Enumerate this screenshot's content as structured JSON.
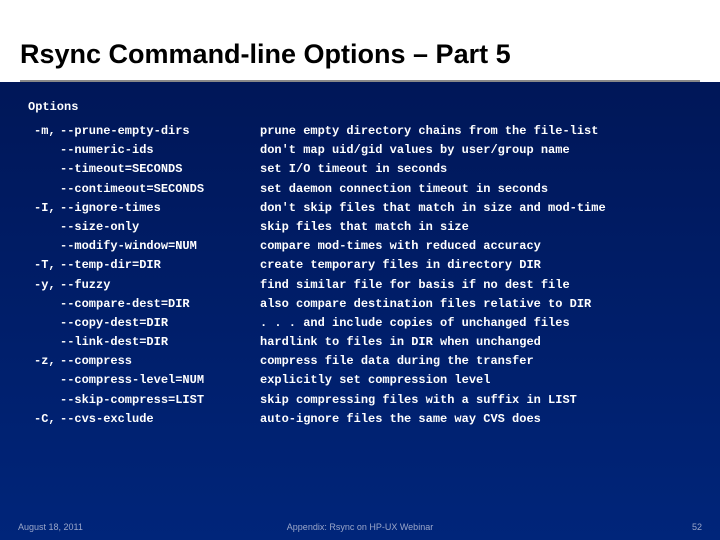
{
  "title": "Rsync Command-line Options – Part 5",
  "section_header": "Options",
  "options": [
    {
      "short": "-m,",
      "long": "--prune-empty-dirs",
      "desc": "prune empty directory chains from the file-list"
    },
    {
      "short": "",
      "long": "--numeric-ids",
      "desc": "don't map uid/gid values by user/group name"
    },
    {
      "short": "",
      "long": "--timeout=SECONDS",
      "desc": "set I/O timeout in seconds"
    },
    {
      "short": "",
      "long": "--contimeout=SECONDS",
      "desc": "set daemon connection timeout in seconds"
    },
    {
      "short": "-I,",
      "long": "--ignore-times",
      "desc": "don't skip files that match in size and mod-time"
    },
    {
      "short": "",
      "long": "--size-only",
      "desc": "skip files that match in size"
    },
    {
      "short": "",
      "long": "--modify-window=NUM",
      "desc": "compare mod-times with reduced accuracy"
    },
    {
      "short": "-T,",
      "long": "--temp-dir=DIR",
      "desc": "create temporary files in directory DIR"
    },
    {
      "short": "-y,",
      "long": "--fuzzy",
      "desc": "find similar file for basis if no dest file"
    },
    {
      "short": "",
      "long": "--compare-dest=DIR",
      "desc": "also compare destination files relative to DIR"
    },
    {
      "short": "",
      "long": "--copy-dest=DIR",
      "desc": ". . . and include copies of unchanged files"
    },
    {
      "short": "",
      "long": "--link-dest=DIR",
      "desc": "hardlink to files in DIR when unchanged"
    },
    {
      "short": "-z,",
      "long": "--compress",
      "desc": "compress file data during the transfer"
    },
    {
      "short": "",
      "long": "--compress-level=NUM",
      "desc": "explicitly set compression level"
    },
    {
      "short": "",
      "long": "--skip-compress=LIST",
      "desc": "skip compressing files with a suffix in LIST"
    },
    {
      "short": "-C,",
      "long": "--cvs-exclude",
      "desc": "auto-ignore files the same way CVS does"
    }
  ],
  "footer": {
    "date": "August 18, 2011",
    "center": "Appendix: Rsync on HP-UX Webinar",
    "page": "52"
  }
}
